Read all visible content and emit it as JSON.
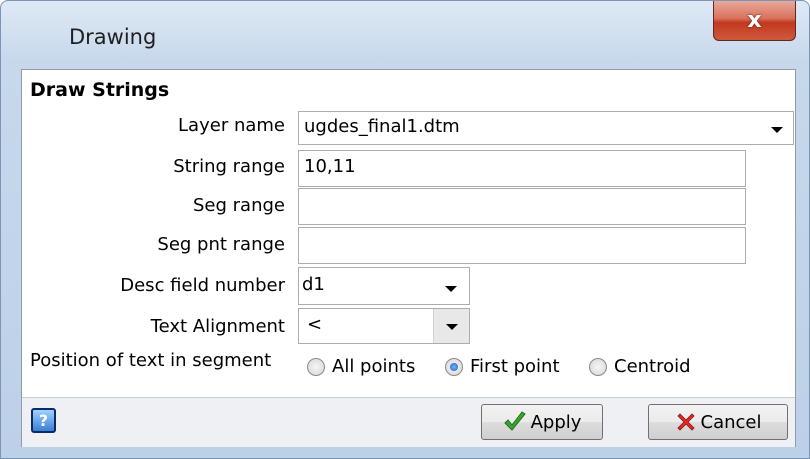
{
  "window": {
    "title": "Drawing",
    "close_glyph": "x"
  },
  "section": {
    "title": "Draw Strings"
  },
  "fields": {
    "layer_name": {
      "label": "Layer name",
      "value": "ugdes_final1.dtm"
    },
    "string_range": {
      "label": "String range",
      "value": "10,11"
    },
    "seg_range": {
      "label": "Seg range",
      "value": ""
    },
    "seg_pnt_range": {
      "label": "Seg pnt range",
      "value": ""
    },
    "desc_field_number": {
      "label": "Desc field number",
      "value": "d1"
    },
    "text_alignment": {
      "label": "Text Alignment",
      "value": "<"
    }
  },
  "position": {
    "label": "Position of text in segment",
    "options": [
      {
        "label": "All points",
        "selected": false
      },
      {
        "label": "First point",
        "selected": true
      },
      {
        "label": "Centroid",
        "selected": false
      }
    ]
  },
  "buttons": {
    "help_glyph": "?",
    "apply": "Apply",
    "cancel": "Cancel"
  },
  "icons": {
    "close": "close-icon",
    "help": "help-icon",
    "apply": "checkmark-icon",
    "cancel": "red-x-icon",
    "dropdown": "chevron-down-icon"
  }
}
